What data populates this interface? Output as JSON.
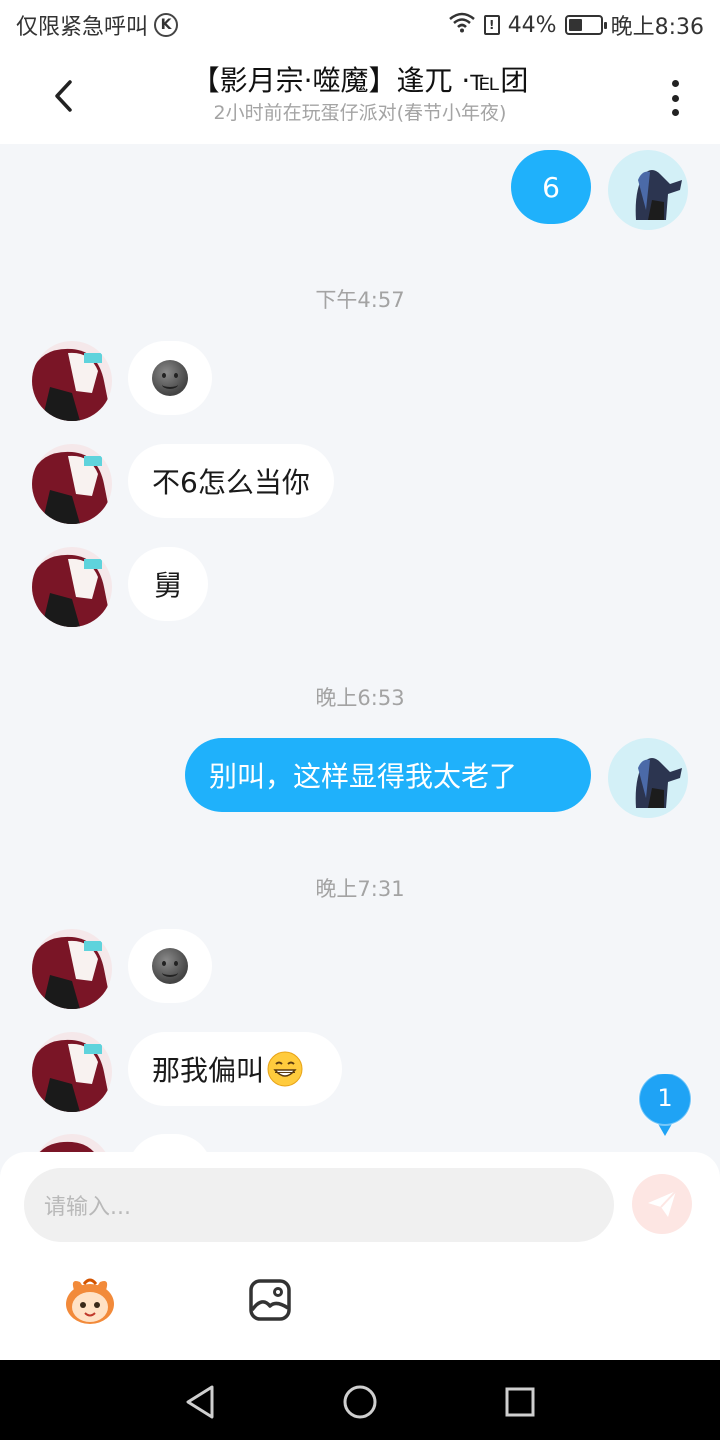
{
  "status_bar": {
    "carrier_text": "仅限紧急呼叫",
    "k_badge": "K",
    "battery_percent_text": "44%",
    "battery_level": 0.44,
    "time": "晚上8:36",
    "icons": [
      "k-circle-icon",
      "wifi-icon",
      "alert-icon",
      "battery-icon"
    ]
  },
  "header": {
    "title": "【影月宗·噬魔】逢兀 ·℡团",
    "subtitle": "2小时前在玩蛋仔派对(春节小年夜)",
    "icons": [
      "back-chevron-icon",
      "more-vertical-icon"
    ]
  },
  "messages": {
    "m1": {
      "direction": "out",
      "text": "6"
    },
    "t1": "下午4:57",
    "m2": {
      "direction": "in",
      "emoji": "dark-smiley-emoji"
    },
    "m3": {
      "direction": "in",
      "text": "不6怎么当你"
    },
    "m4": {
      "direction": "in",
      "text": "舅"
    },
    "t2": "晚上6:53",
    "m5": {
      "direction": "out",
      "text": "别叫，这样显得我太老了"
    },
    "t3": "晚上7:31",
    "m6": {
      "direction": "in",
      "emoji": "dark-smiley-emoji"
    },
    "m7": {
      "direction": "in",
      "text": "那我偏叫",
      "emoji": "grin-emoji"
    }
  },
  "unread_badge": "1",
  "composer": {
    "placeholder": "请输入...",
    "icons": [
      "send-plane-icon",
      "eggy-sticker-icon",
      "image-icon"
    ]
  },
  "nav_bar": {
    "icons": [
      "back-triangle-icon",
      "home-circle-icon",
      "recents-square-icon"
    ]
  },
  "colors": {
    "accent_bubble": "#1fb1fb",
    "background": "#f4f6f9",
    "timestamp": "#a3a3a3",
    "send_disabled": "#fde6e3"
  }
}
